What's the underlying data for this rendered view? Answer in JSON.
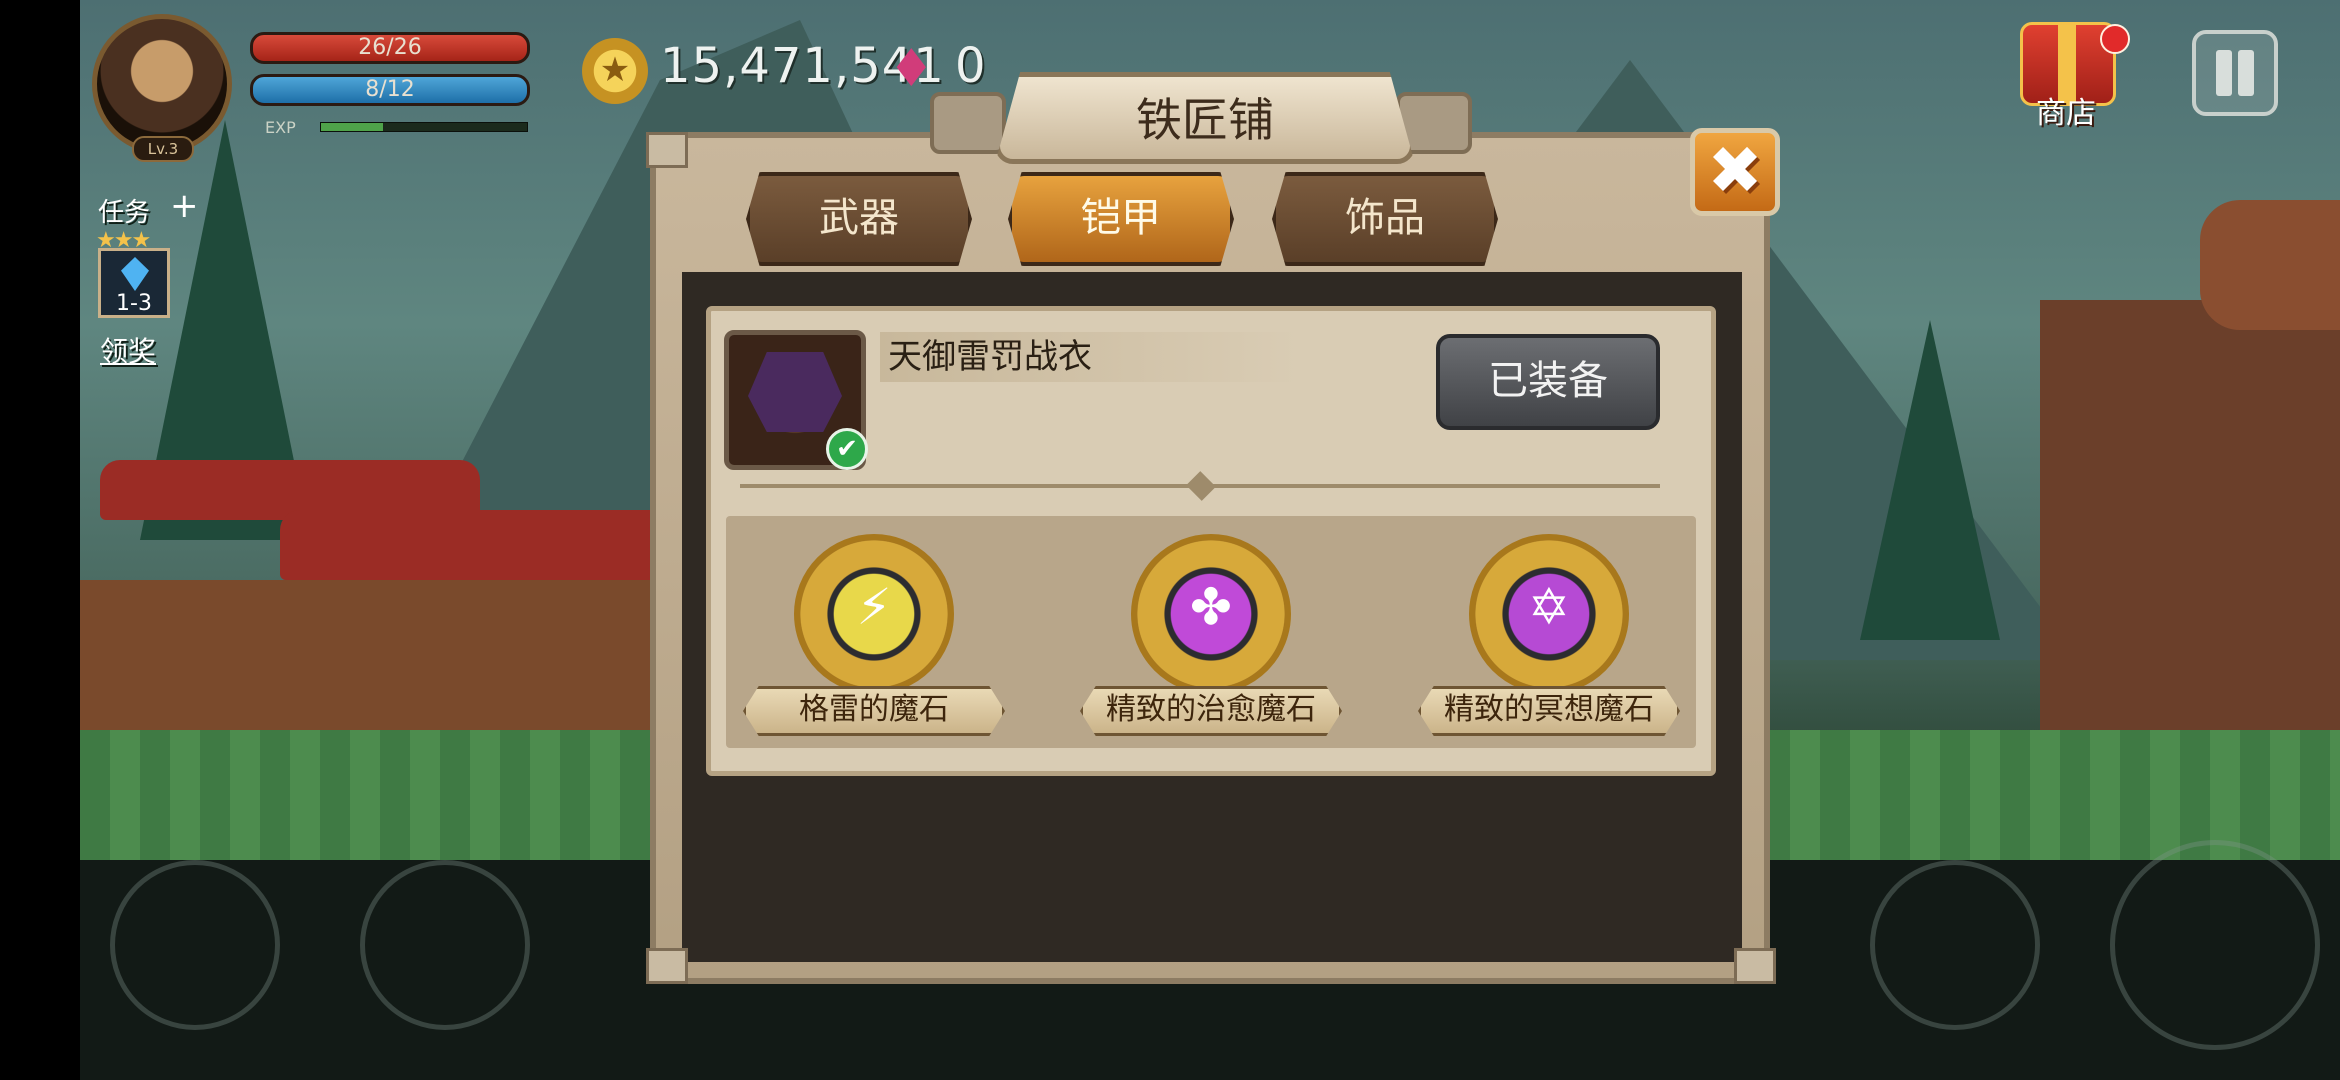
{
  "player": {
    "hp_text": "26/26",
    "mp_text": "8/12",
    "exp_label": "EXP",
    "exp_fraction": 0.3,
    "level": "Lv.3"
  },
  "currency": {
    "coins": "15,471,541",
    "gems": "0"
  },
  "shop": {
    "label": "商店"
  },
  "quest": {
    "title": "任务",
    "stars": "★★★",
    "stage": "1-3",
    "claim_label": "领奖"
  },
  "blacksmith": {
    "title": "铁匠铺",
    "close_glyph": "✖",
    "tabs": [
      {
        "label": "武器",
        "active": false
      },
      {
        "label": "铠甲",
        "active": true
      },
      {
        "label": "饰品",
        "active": false
      }
    ],
    "item": {
      "name": "天御雷罚战衣",
      "status_button": "已装备",
      "check_glyph": "✔"
    },
    "stones": [
      {
        "label": "格雷的魔石",
        "icon": "thunder-stone-icon",
        "glyph": "⚡",
        "color": "#e8d84a"
      },
      {
        "label": "精致的治愈魔石",
        "icon": "clover-stone-icon",
        "glyph": "✤",
        "color": "#c04ad8"
      },
      {
        "label": "精致的冥想魔石",
        "icon": "star-stone-icon",
        "glyph": "✡",
        "color": "#b64ad4"
      }
    ]
  }
}
